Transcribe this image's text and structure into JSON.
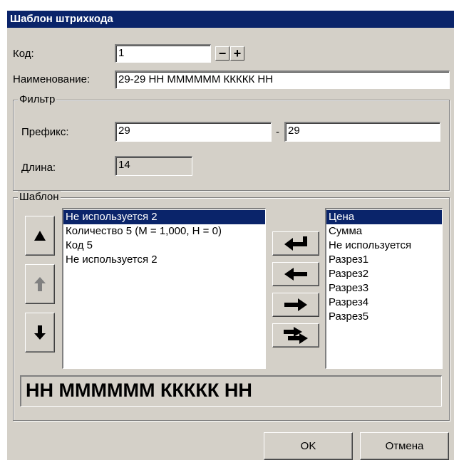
{
  "window": {
    "title": "Шаблон штрихкода"
  },
  "code": {
    "label": "Код:",
    "value": "1",
    "minus": "−",
    "plus": "+"
  },
  "name": {
    "label": "Наименование:",
    "value": "29-29 НН ММММММ ККККК НН"
  },
  "filter": {
    "title": "Фильтр",
    "prefix_label": "Префикс:",
    "prefix_from": "29",
    "separator": "-",
    "prefix_to": "29",
    "length_label": "Длина:",
    "length_value": "14"
  },
  "template": {
    "title": "Шаблон",
    "left_items": [
      "Не используется 2",
      "Количество 5 (М = 1,000, Н = 0)",
      "Код 5",
      "Не используется 2"
    ],
    "right_items": [
      "Цена",
      "Сумма",
      "Не используется",
      "Разрез1",
      "Разрез2",
      "Разрез3",
      "Разрез4",
      "Разрез5"
    ],
    "preview": "НН ММММММ ККККК НН"
  },
  "buttons": {
    "ok": "OK",
    "cancel": "Отмена"
  }
}
